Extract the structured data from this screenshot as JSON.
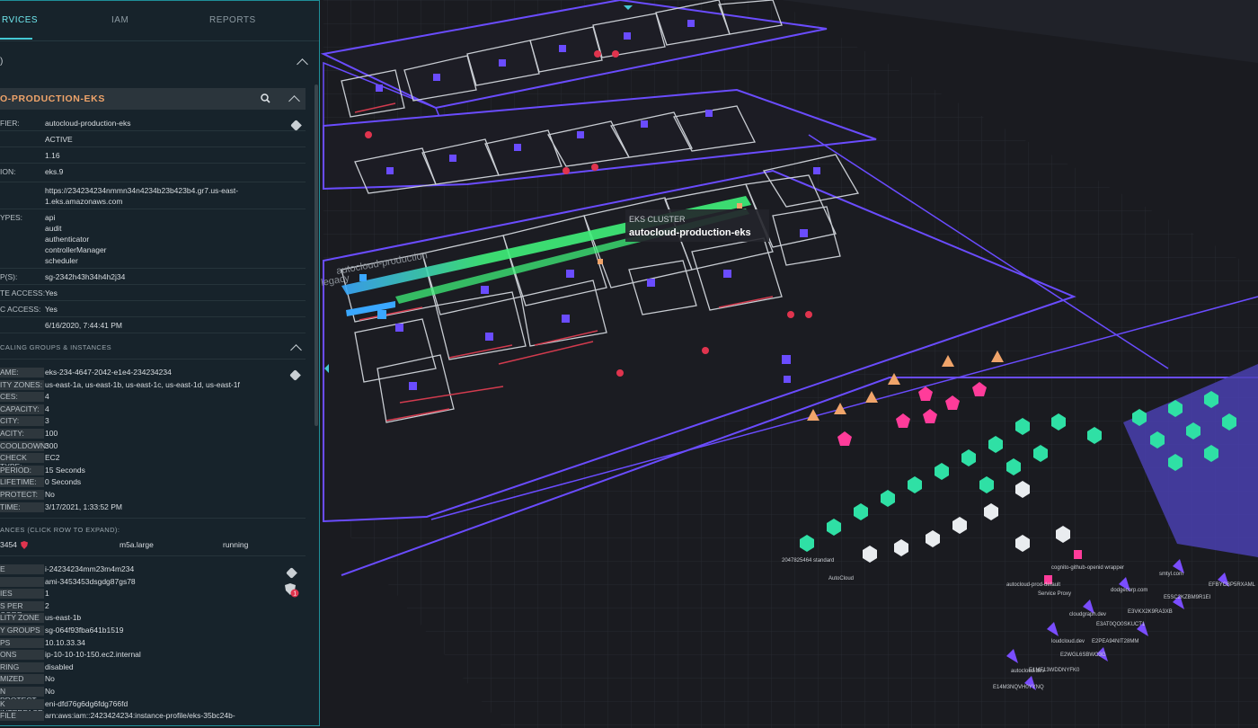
{
  "tabs": [
    {
      "label": "RVICES",
      "active": true
    },
    {
      "label": "IAM",
      "active": false
    },
    {
      "label": "REPORTS",
      "active": false
    }
  ],
  "section_marker": ")",
  "cluster_header": "O-PRODUCTION-EKS",
  "cluster_fields": [
    {
      "k": "FIER:",
      "v": "autocloud-production-eks"
    },
    {
      "k": "",
      "v": "ACTIVE"
    },
    {
      "k": "",
      "v": "1.16"
    },
    {
      "k": "ION:",
      "v": "eks.9"
    },
    {
      "k": "",
      "v": "https://234234234nmmn34n4234b23b423b4.gr7.us-east-"
    },
    {
      "k": "",
      "v": "1.eks.amazonaws.com"
    },
    {
      "k": "YPES:",
      "v": "api"
    },
    {
      "k": "",
      "v": "audit"
    },
    {
      "k": "",
      "v": "authenticator"
    },
    {
      "k": "",
      "v": "controllerManager"
    },
    {
      "k": "",
      "v": "scheduler"
    },
    {
      "k": "P(S):",
      "v": "sg-2342h43h34h4h2j34"
    },
    {
      "k": "TE ACCESS:",
      "v": "Yes"
    },
    {
      "k": "C ACCESS:",
      "v": "Yes"
    },
    {
      "k": "",
      "v": "6/16/2020, 7:44:41 PM"
    }
  ],
  "asg_section_label": "CALING GROUPS & INSTANCES",
  "asg_fields": [
    {
      "k": "AME:",
      "v": "eks-234-4647-2042-e1e4-234234234"
    },
    {
      "k": "ITY ZONES:",
      "v": "us-east-1a, us-east-1b, us-east-1c, us-east-1d, us-east-1f"
    },
    {
      "k": "CES:",
      "v": "4"
    },
    {
      "k": "CAPACITY:",
      "v": "4"
    },
    {
      "k": "CITY:",
      "v": "3"
    },
    {
      "k": "ACITY:",
      "v": "100"
    },
    {
      "k": "COOLDOWN:",
      "v": "300"
    },
    {
      "k": "CHECK TYPE:",
      "v": "EC2"
    },
    {
      "k": "PERIOD:",
      "v": "15 Seconds"
    },
    {
      "k": "LIFETIME:",
      "v": "0 Seconds"
    },
    {
      "k": "PROTECT:",
      "v": "No"
    },
    {
      "k": "TIME:",
      "v": "3/17/2021, 1:33:52 PM"
    }
  ],
  "instances_label": "ANCES (CLICK ROW TO EXPAND):",
  "instance_row": {
    "id": "3454",
    "type": "m5a.large",
    "state": "running"
  },
  "instance_fields": [
    {
      "k": "E",
      "v": "i-24234234mm23m4m234"
    },
    {
      "k": "",
      "v": "ami-3453453dsgdg87gs78"
    },
    {
      "k": "IES",
      "v": "1"
    },
    {
      "k": "S PER CORE",
      "v": "2"
    },
    {
      "k": "LITY ZONE",
      "v": "us-east-1b"
    },
    {
      "k": "Y GROUPS",
      "v": "sg-064f93fba641b1519"
    },
    {
      "k": "PS",
      "v": "10.10.33.34"
    },
    {
      "k": "ONS",
      "v": "ip-10-10-10-150.ec2.internal"
    },
    {
      "k": "RING",
      "v": "disabled"
    },
    {
      "k": "MIZED",
      "v": "No"
    },
    {
      "k": "N PROTECT",
      "v": "No"
    },
    {
      "k": "K INTERFACE",
      "v": "eni-dfd76g6dg6fdg766fd"
    },
    {
      "k": "FILE",
      "v": "arn:aws:iam::2423424234:instance-profile/eks-35bc24b-"
    }
  ],
  "tooltip": {
    "kind": "EKS CLUSTER",
    "name": "autocloud-production-eks"
  },
  "canvas_labels": {
    "legacy": "autocloud-production",
    "legacy2": "legacy",
    "autocloud": "AutoCloud",
    "service_proxy": "Service Proxy",
    "fargate": "2047825464 standard",
    "cognito_wrapper": "cognito-github-openid wrapper",
    "prod_default": "autocloud-prod-default",
    "loudcloud": "loudcloud.dev",
    "cloudgraph": "cloudgraph.dev",
    "autocloud_dev": "autocloud.dev",
    "smtyl": "smtyl.com",
    "dodge": "dodgecorp.com",
    "k1": "EFBYCBP5RXAML",
    "k2": "E5SC2KZBM9R1EI",
    "k3": "E3VKX2K9RA3XB",
    "k4": "E3AT0QO0SKUCT1",
    "k5": "E2PEA94NIT28MM",
    "k6": "E2WGL6SBWO3G",
    "k7": "E1MF13WDDNYFK0",
    "k8": "E14M3NQVH0YYNQ"
  },
  "colors": {
    "accent": "#44c7d3",
    "cluster_orange": "#f0a46a",
    "purple": "#6a4cff",
    "green": "#3ff07a",
    "pink": "#ff3c9a",
    "teal": "#2fe0a5"
  },
  "icons": [
    "search-icon",
    "chevron-up-icon",
    "tag-icon",
    "shield-icon",
    "alert-badge-icon"
  ]
}
